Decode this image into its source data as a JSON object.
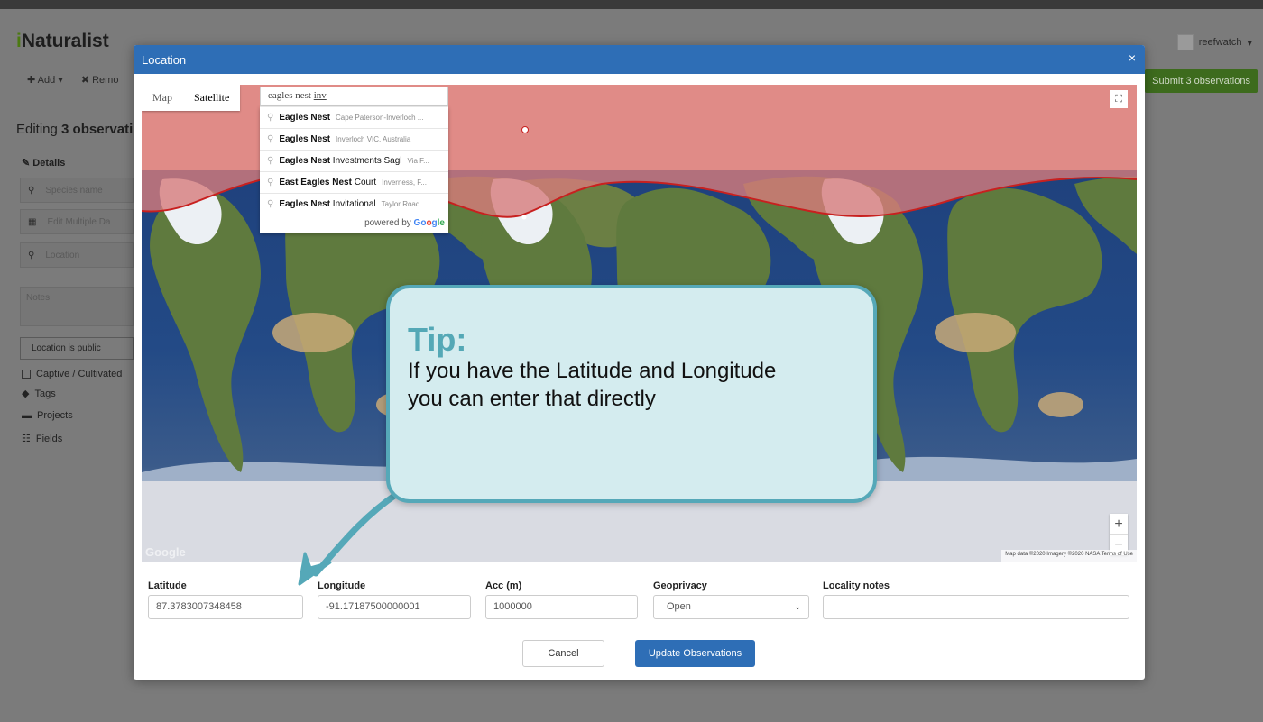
{
  "page": {
    "brand": "iNaturalist",
    "user": "reefwatch",
    "toolbar": {
      "add": "Add",
      "remove": "Remo"
    },
    "submit_button": "Submit 3 observations",
    "editing_title_prefix": "Editing ",
    "editing_title_bold": "3 observati",
    "details_heading": "Details",
    "fields": {
      "species": "Species name",
      "date": "Edit Multiple Da",
      "location": "Location",
      "notes": "Notes"
    },
    "location_public": "Location is public",
    "captive": "Captive / Cultivated",
    "tags": "Tags",
    "projects": "Projects",
    "fields_link": "Fields"
  },
  "modal": {
    "title": "Location",
    "close": "×",
    "map": {
      "type_map": "Map",
      "type_satellite": "Satellite",
      "search_value": "eagles nest ",
      "search_underlined": "inv",
      "suggestions": [
        {
          "bold": "Eagles Nest",
          "rest": "",
          "secondary": "Cape Paterson-Inverloch ..."
        },
        {
          "bold": "Eagles Nest",
          "rest": "",
          "secondary": "Inverloch VIC, Australia"
        },
        {
          "bold": "Eagles Nest",
          "rest": " Investments Sagl",
          "secondary": "Via F..."
        },
        {
          "bold": "East Eagles Nest",
          "rest": " Court",
          "secondary": "Inverness, F..."
        },
        {
          "bold": "Eagles Nest",
          "rest": " Invitational",
          "secondary": "Taylor Road..."
        }
      ],
      "powered_by": "powered by ",
      "google_letters": [
        "Go",
        "o",
        "g",
        "le"
      ],
      "google_logo": "Google",
      "attribution": "Map data ©2020 Imagery ©2020 NASA   Terms of Use",
      "zoom_in": "+",
      "zoom_out": "−"
    },
    "form": {
      "latitude_label": "Latitude",
      "latitude_value": "87.3783007348458",
      "longitude_label": "Longitude",
      "longitude_value": "-91.17187500000001",
      "acc_label": "Acc (m)",
      "acc_value": "1000000",
      "geoprivacy_label": "Geoprivacy",
      "geoprivacy_value": "Open",
      "locality_label": "Locality notes",
      "locality_value": ""
    },
    "cancel": "Cancel",
    "update": "Update Observations"
  },
  "tip": {
    "title": "Tip:",
    "text": "If you have the Latitude and Longitude you can enter that directly"
  },
  "colors": {
    "header_blue": "#2e6eb6",
    "tip_teal": "#55a8b8",
    "submit_green": "#3d6b1d"
  }
}
